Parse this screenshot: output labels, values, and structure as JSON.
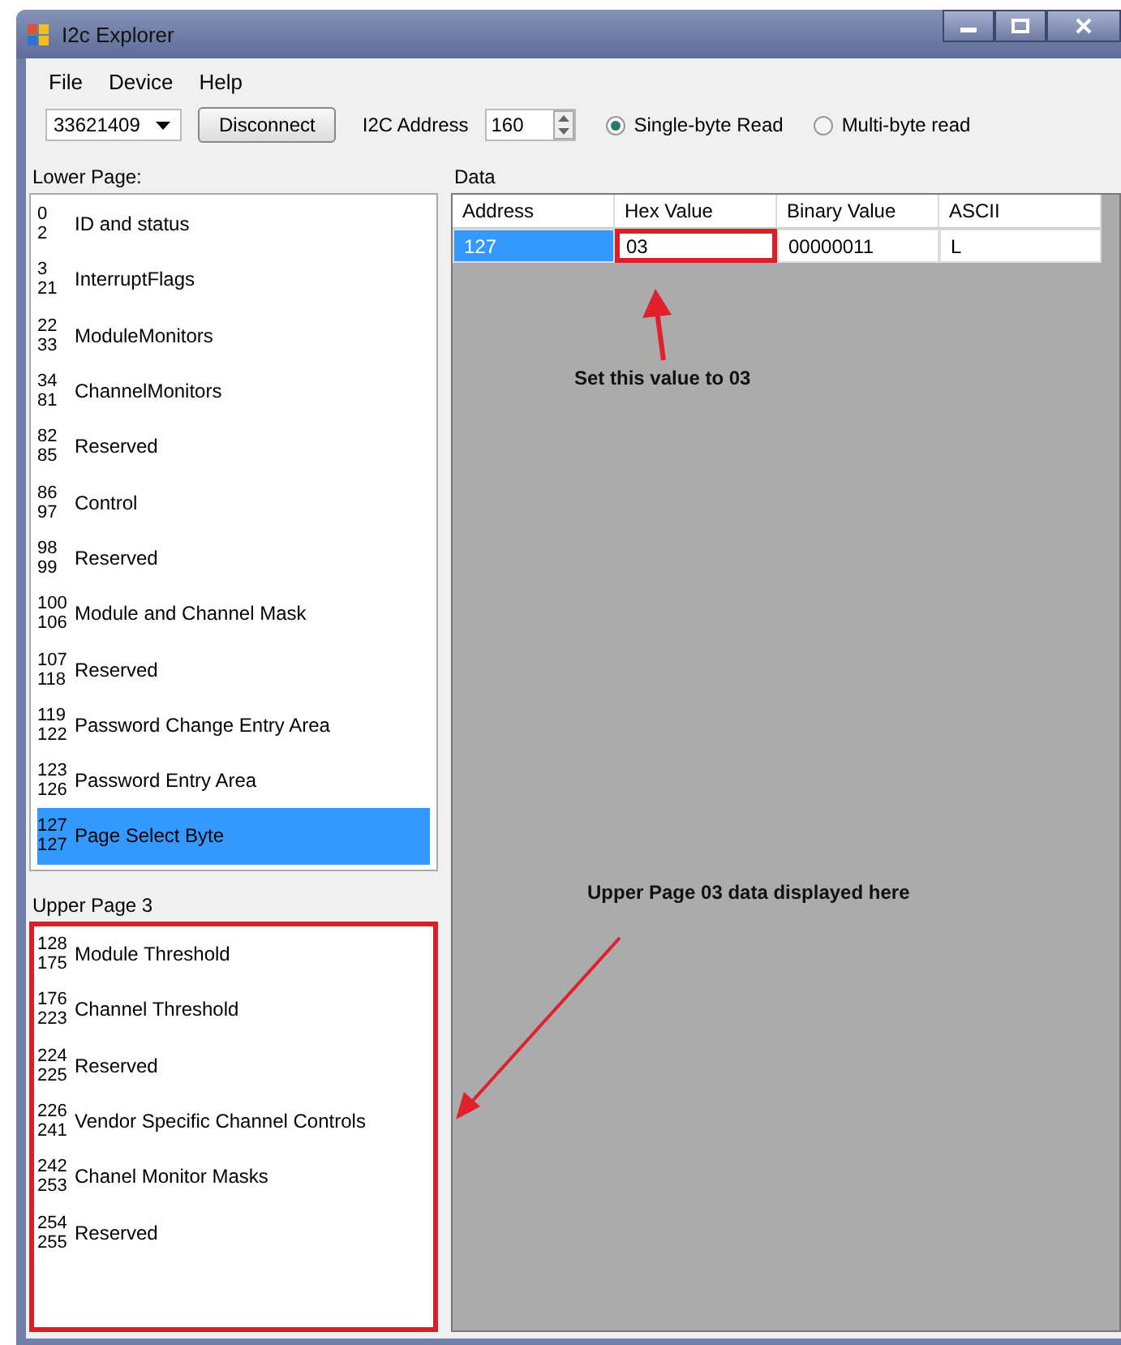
{
  "window": {
    "title": "I2c Explorer"
  },
  "menu": [
    "File",
    "Device",
    "Help"
  ],
  "toolbar": {
    "device": "33621409",
    "connect_button": "Disconnect",
    "address_label": "I2C Address",
    "address": "160",
    "read_modes": [
      {
        "label": "Single-byte Read",
        "selected": true
      },
      {
        "label": "Multi-byte read",
        "selected": false
      }
    ]
  },
  "lower_page": {
    "title": "Lower Page:",
    "highlighted": false,
    "items": [
      {
        "start": "0",
        "end": "2",
        "name": "ID and status",
        "selected": false
      },
      {
        "start": "3",
        "end": "21",
        "name": "InterruptFlags",
        "selected": false
      },
      {
        "start": "22",
        "end": "33",
        "name": "ModuleMonitors",
        "selected": false
      },
      {
        "start": "34",
        "end": "81",
        "name": "ChannelMonitors",
        "selected": false
      },
      {
        "start": "82",
        "end": "85",
        "name": "Reserved",
        "selected": false
      },
      {
        "start": "86",
        "end": "97",
        "name": "Control",
        "selected": false
      },
      {
        "start": "98",
        "end": "99",
        "name": "Reserved",
        "selected": false
      },
      {
        "start": "100",
        "end": "106",
        "name": "Module and Channel Mask",
        "selected": false
      },
      {
        "start": "107",
        "end": "118",
        "name": "Reserved",
        "selected": false
      },
      {
        "start": "119",
        "end": "122",
        "name": "Password Change Entry Area",
        "selected": false
      },
      {
        "start": "123",
        "end": "126",
        "name": "Password Entry Area",
        "selected": false
      },
      {
        "start": "127",
        "end": "127",
        "name": "Page Select Byte",
        "selected": true
      }
    ]
  },
  "upper_page": {
    "title": "Upper Page 3",
    "highlighted": true,
    "items": [
      {
        "start": "128",
        "end": "175",
        "name": "Module Threshold",
        "selected": false
      },
      {
        "start": "176",
        "end": "223",
        "name": "Channel Threshold",
        "selected": false
      },
      {
        "start": "224",
        "end": "225",
        "name": "Reserved",
        "selected": false
      },
      {
        "start": "226",
        "end": "241",
        "name": "Vendor Specific Channel Controls",
        "selected": false
      },
      {
        "start": "242",
        "end": "253",
        "name": "Chanel Monitor Masks",
        "selected": false
      },
      {
        "start": "254",
        "end": "255",
        "name": "Reserved",
        "selected": false
      }
    ]
  },
  "data": {
    "title": "Data",
    "columns": [
      "Address",
      "Hex Value",
      "Binary Value",
      "ASCII"
    ],
    "rows": [
      {
        "cells": [
          {
            "text": "127",
            "selected": true,
            "highlighted": false
          },
          {
            "text": "03",
            "selected": false,
            "highlighted": true
          },
          {
            "text": "00000011",
            "selected": false,
            "highlighted": false
          },
          {
            "text": "L",
            "selected": false,
            "highlighted": false
          }
        ]
      }
    ]
  },
  "annotations": [
    {
      "text": "Set this value to 03"
    },
    {
      "text": "Upper Page 03 data displayed here"
    }
  ]
}
